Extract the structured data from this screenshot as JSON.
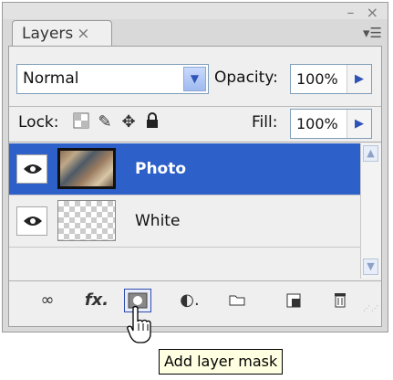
{
  "panel": {
    "tab_label": "Layers",
    "tab_close": "×",
    "window_controls": "– ×",
    "menu_icon": "panel-menu-icon"
  },
  "blend": {
    "mode": "Normal",
    "opacity_label": "Opacity:",
    "opacity_value": "100%"
  },
  "lock": {
    "label": "Lock:",
    "icons": [
      "lock-transparent-icon",
      "lock-brush-icon",
      "lock-move-icon",
      "lock-all-icon"
    ],
    "fill_label": "Fill:",
    "fill_value": "100%"
  },
  "layers": [
    {
      "name": "Photo",
      "selected": true,
      "visible": true
    },
    {
      "name": "White",
      "selected": false,
      "visible": true
    }
  ],
  "toolbar": {
    "buttons": [
      "link-layers-icon",
      "layer-style-icon",
      "add-layer-mask-icon",
      "adjustment-layer-icon",
      "new-group-icon",
      "new-layer-icon",
      "delete-layer-icon"
    ],
    "fx_text": "fx"
  },
  "tooltip": {
    "text": "Add layer mask"
  },
  "colors": {
    "selection": "#2d60c8",
    "panel_bg": "#efefef",
    "tooltip_bg": "#ffffe1"
  }
}
